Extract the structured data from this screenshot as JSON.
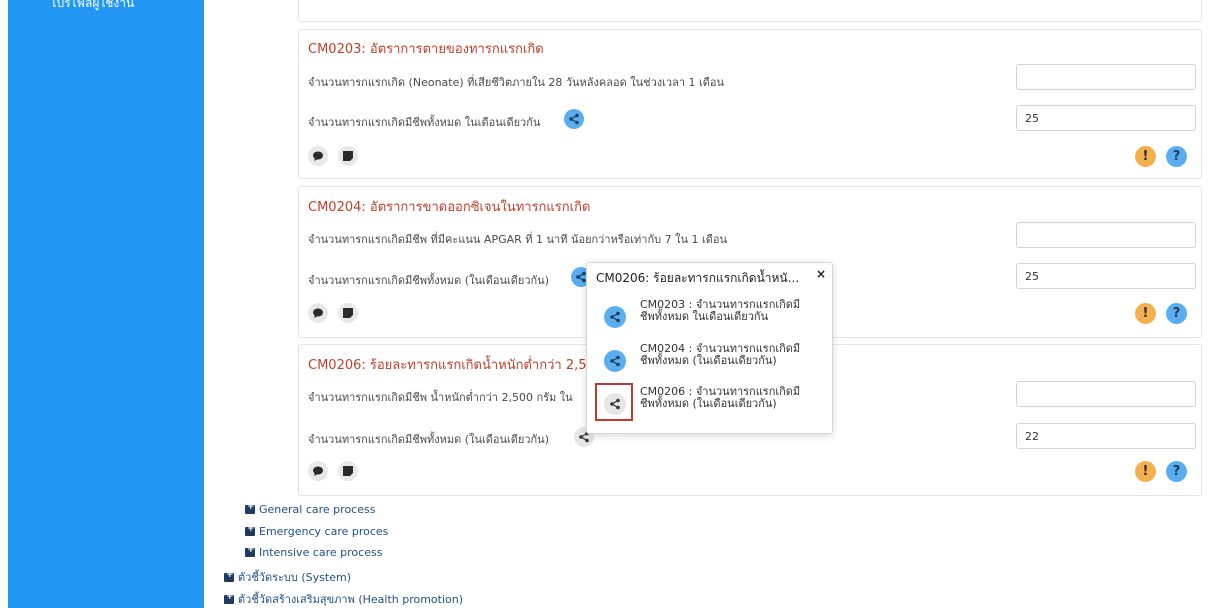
{
  "sidebar": {
    "top_item_cut": "โปรไฟล์ผู้ใช้งาน"
  },
  "cards": [
    {
      "title": "CM0203: อัตราการตายของทารกแรกเกิด",
      "q1": "จำนวนทารกแรกเกิด (Neonate) ที่เสียชีวิตภายใน 28 วันหลังคลอด ในช่วงเวลา 1 เดือน",
      "q1_value": "",
      "q2": "จำนวนทารกแรกเกิดมีชีพทั้งหมด ในเดือนเดียวกัน",
      "q2_value": "25"
    },
    {
      "title": "CM0204: อัตราการขาดออกซิเจนในทารกแรกเกิด",
      "q1": "จำนวนทารกแรกเกิดมีชีพ ที่มีคะแนน APGAR ที่ 1 นาที น้อยกว่าหรือเท่ากับ 7 ใน 1 เดือน",
      "q1_value": "",
      "q2": "จำนวนทารกแรกเกิดมีชีพทั้งหมด (ในเดือนเดียวกัน)",
      "q2_value": "25"
    },
    {
      "title": "CM0206: ร้อยละทารกแรกเกิดน้ำหนักต่ำกว่า 2,5",
      "q1": "จำนวนทารกแรกเกิดมีชีพ น้ำหนักต่ำกว่า 2,500 กรัม ใน",
      "q1_value": "",
      "q2": "จำนวนทารกแรกเกิดมีชีพทั้งหมด (ในเดือนเดียวกัน)",
      "q2_value": "22"
    }
  ],
  "badges": {
    "warn": "!",
    "help": "?"
  },
  "popup": {
    "title": "CM0206: ร้อยละทารกแรกเกิดน้ำหนั...",
    "close": "×",
    "items": [
      {
        "line1": "CM0203 : จำนวนทารกแรกเกิดมี",
        "line2": "ชีพทั้งหมด ในเดือนเดียวกัน"
      },
      {
        "line1": "CM0204 : จำนวนทารกแรกเกิดมี",
        "line2": "ชีพทั้งหมด (ในเดือนเดียวกัน)"
      },
      {
        "line1": "CM0206 : จำนวนทารกแรกเกิดมี",
        "line2": "ชีพทั้งหมด (ในเดือนเดียวกัน)"
      }
    ]
  },
  "tree": {
    "sub": [
      "General care process",
      "Emergency care proces",
      "Intensive care process"
    ],
    "top": [
      "ตัวชี้วัดระบบ (System)",
      "ตัวชี้วัดสร้างเสริมสุขภาพ (Health promotion)"
    ]
  },
  "colors": {
    "sidebar": "#2196f3",
    "title": "#c0402a",
    "share": "#5aaef0",
    "warn": "#f4b04e",
    "link": "#1f4f8f"
  }
}
